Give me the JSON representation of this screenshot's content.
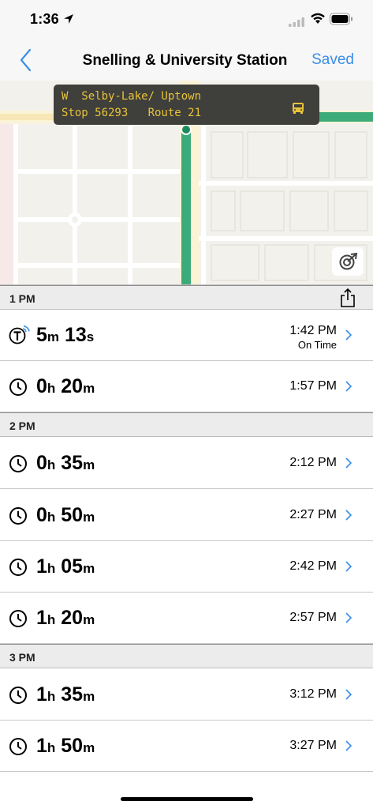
{
  "status_bar": {
    "time": "1:36"
  },
  "nav": {
    "back_icon": "chevron-left-icon",
    "title": "Snelling & University Station",
    "saved_label": "Saved"
  },
  "map": {
    "sign_line1": "W  Selby-Lake/ Uptown",
    "sign_line2": "Stop 56293   Route 21",
    "route_color": "#3daa7a",
    "sign_text_color": "#e8c33a"
  },
  "colors": {
    "accent": "#3a8ee6"
  },
  "sections": [
    {
      "label": "1 PM",
      "rows": [
        {
          "icon": "realtime-transit-icon",
          "hours": "5",
          "hours_unit": "m",
          "minutes": "13",
          "minutes_unit": "s",
          "time": "1:42 PM",
          "status": "On Time"
        },
        {
          "icon": "clock-icon",
          "hours": "0",
          "hours_unit": "h",
          "minutes": "20",
          "minutes_unit": "m",
          "time": "1:57 PM"
        }
      ]
    },
    {
      "label": "2 PM",
      "rows": [
        {
          "icon": "clock-icon",
          "hours": "0",
          "hours_unit": "h",
          "minutes": "35",
          "minutes_unit": "m",
          "time": "2:12 PM"
        },
        {
          "icon": "clock-icon",
          "hours": "0",
          "hours_unit": "h",
          "minutes": "50",
          "minutes_unit": "m",
          "time": "2:27 PM"
        },
        {
          "icon": "clock-icon",
          "hours": "1",
          "hours_unit": "h",
          "minutes": "05",
          "minutes_unit": "m",
          "time": "2:42 PM"
        },
        {
          "icon": "clock-icon",
          "hours": "1",
          "hours_unit": "h",
          "minutes": "20",
          "minutes_unit": "m",
          "time": "2:57 PM"
        }
      ]
    },
    {
      "label": "3 PM",
      "rows": [
        {
          "icon": "clock-icon",
          "hours": "1",
          "hours_unit": "h",
          "minutes": "35",
          "minutes_unit": "m",
          "time": "3:12 PM"
        },
        {
          "icon": "clock-icon",
          "hours": "1",
          "hours_unit": "h",
          "minutes": "50",
          "minutes_unit": "m",
          "time": "3:27 PM"
        }
      ]
    }
  ]
}
